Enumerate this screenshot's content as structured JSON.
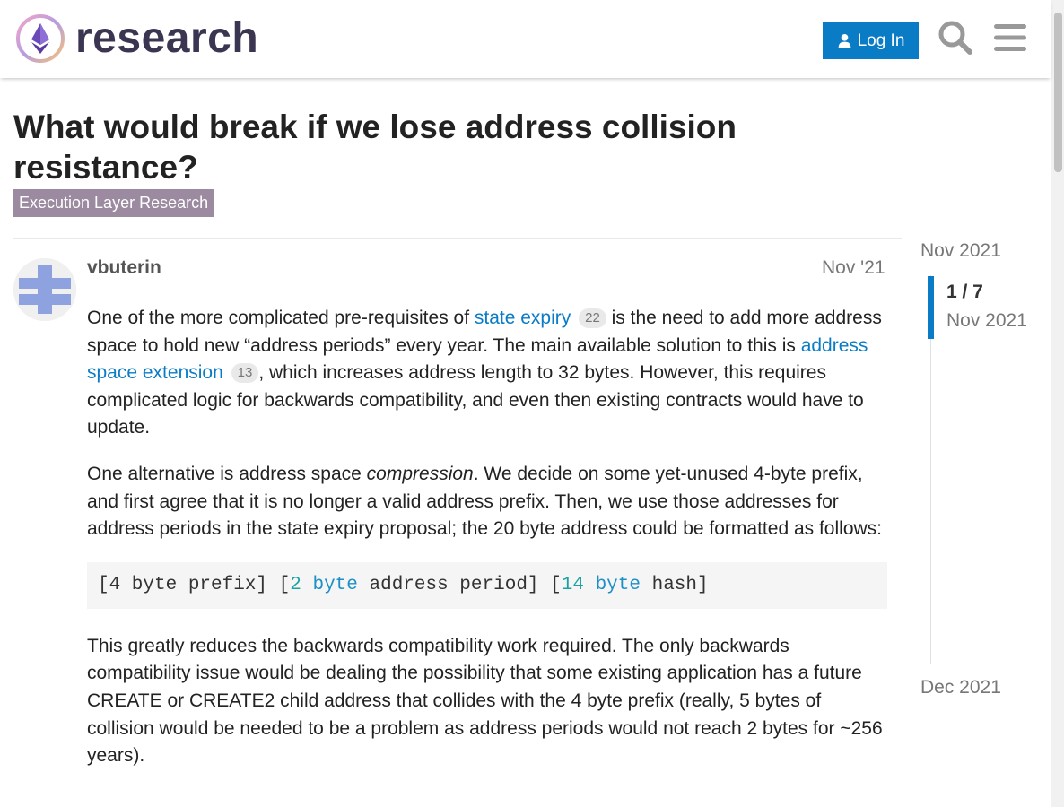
{
  "header": {
    "brand": "research",
    "login_label": "Log In",
    "search_icon": "search-icon",
    "menu_icon": "hamburger-menu-icon",
    "accent": "#0a7cc6"
  },
  "topic": {
    "title": "What would break if we lose address collision resistance?",
    "category": "Execution Layer Research",
    "category_color": "#9b8aa0"
  },
  "post": {
    "username": "vbuterin",
    "date": "Nov '21",
    "p1_a": "One of the more complicated pre-requisites of ",
    "link1": "state expiry",
    "link1_count": "22",
    "p1_b": " is the need to add more address space to hold new “address periods” every year. The main available solution to this is ",
    "link2": "address space extension",
    "link2_count": "13",
    "p1_c": ", which increases address length to 32 bytes. However, this requires complicated logic for backwards compatibility, and even then existing contracts would have to update.",
    "p2_a": "One alternative is address space ",
    "p2_em": "compression",
    "p2_b": ". We decide on some yet-unused 4-byte prefix, and first agree that it is no longer a valid address prefix. Then, we use those addresses for address periods in the state expiry proposal; the 20 byte address could be formatted as follows:",
    "code": {
      "t1": "[4 byte prefix] [",
      "n1": "2",
      "s1": " ",
      "k1": "byte",
      "t2": " address period] [",
      "n2": "14",
      "s2": " ",
      "k2": "byte",
      "t3": " hash]"
    },
    "p3": "This greatly reduces the backwards compatibility work required. The only backwards compatibility issue would be dealing the possibility that some existing application has a future CREATE or CREATE2 child address that collides with the 4 byte prefix (really, 5 bytes of collision would be needed to be a problem as address periods would not reach 2 bytes for ~256 years)."
  },
  "timeline": {
    "start": "Nov 2021",
    "position": "1 / 7",
    "position_date": "Nov 2021",
    "end": "Dec 2021"
  }
}
